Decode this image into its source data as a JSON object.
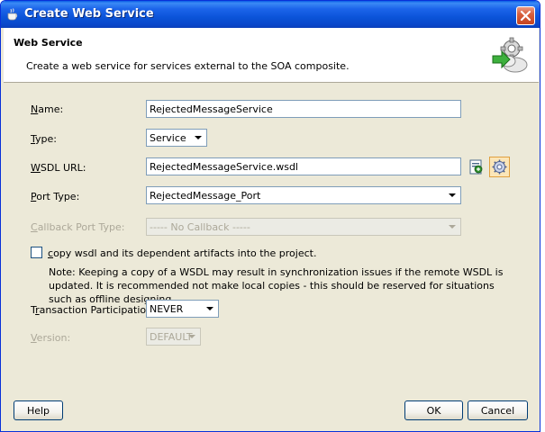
{
  "window": {
    "title": "Create Web Service"
  },
  "header": {
    "title": "Web Service",
    "description": "Create a web service for services external to the SOA composite."
  },
  "form": {
    "name": {
      "label_accel": "N",
      "label_rest": "ame:",
      "value": "RejectedMessageService"
    },
    "type": {
      "label_accel": "T",
      "label_rest": "ype:",
      "value": "Service"
    },
    "wsdl_url": {
      "label_accel": "W",
      "label_rest": "SDL URL:",
      "value": "RejectedMessageService.wsdl"
    },
    "port_type": {
      "label_accel": "P",
      "label_rest": "ort Type:",
      "value": "RejectedMessage_Port"
    },
    "callback_port_type": {
      "label_accel": "C",
      "label_rest": "allback Port Type:",
      "value": "----- No Callback -----"
    },
    "copy_wsdl": {
      "label_accel": "c",
      "label_rest": "opy wsdl and its dependent artifacts into the project.",
      "checked": false
    },
    "note": "Note: Keeping a copy of a WSDL may result in synchronization issues if the remote WSDL is updated. It is recommended not make local copies - this should be reserved for situations such as offline designing.",
    "transaction": {
      "label_pre": "T",
      "label_accel": "r",
      "label_rest": "ansaction Participation:",
      "value": "NEVER"
    },
    "version": {
      "label_accel": "V",
      "label_rest": "ersion:",
      "value": "DEFAULT"
    }
  },
  "buttons": {
    "help": "Help",
    "ok": "OK",
    "cancel": "Cancel"
  },
  "colors": {
    "titlebar": "#0a54d9",
    "dialog_bg": "#ece9d8",
    "field_border": "#7f9db9",
    "disabled_text": "#aca899"
  },
  "icons": [
    "oracle-cup-icon",
    "close-icon",
    "web-service-gear-icon",
    "browse-wsdl-icon",
    "service-explorer-icon"
  ]
}
